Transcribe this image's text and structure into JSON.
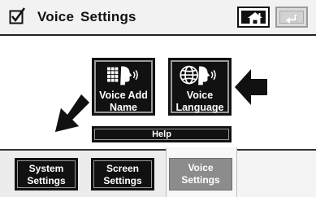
{
  "header": {
    "title": "Voice  Settings",
    "check_icon": "checkbox-check-icon",
    "home_icon": "home-icon",
    "back_icon": "return-arrow-icon"
  },
  "main": {
    "buttons": [
      {
        "line1": "Voice Add",
        "line2": "Name",
        "icon": "grid-speaking-head-icon"
      },
      {
        "line1": "Voice",
        "line2": "Language",
        "icon": "globe-speaking-head-icon"
      }
    ],
    "help_label": "Help"
  },
  "tabs": [
    {
      "line1": "System",
      "line2": "Settings"
    },
    {
      "line1": "Screen",
      "line2": "Settings"
    },
    {
      "line1": "Voice",
      "line2": "Settings"
    }
  ],
  "colors": {
    "button_bg": "#111111",
    "active_tab": "#8c8c8c",
    "header_bg": "#f2f2f2"
  }
}
